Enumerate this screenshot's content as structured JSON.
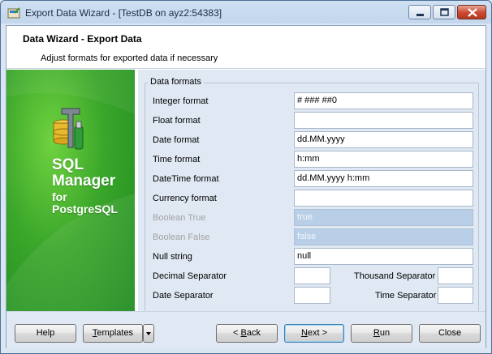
{
  "window": {
    "title": "Export Data Wizard - [TestDB on ayz2:54383]"
  },
  "header": {
    "title": "Data Wizard - Export Data",
    "subtitle": "Adjust formats for exported data if necessary"
  },
  "brand": {
    "line1": "SQL",
    "line2": "Manager",
    "line3": "for",
    "line4": "PostgreSQL"
  },
  "group": {
    "label": "Data formats"
  },
  "fields": {
    "integer_format": {
      "label": "Integer format",
      "value": "# ### ##0"
    },
    "float_format": {
      "label": "Float format",
      "value": ""
    },
    "date_format": {
      "label": "Date format",
      "value": "dd.MM.yyyy"
    },
    "time_format": {
      "label": "Time format",
      "value": "h:mm"
    },
    "datetime_format": {
      "label": "DateTime format",
      "value": "dd.MM.yyyy h:mm"
    },
    "currency_format": {
      "label": "Currency format",
      "value": ""
    },
    "boolean_true": {
      "label": "Boolean True",
      "value": "true"
    },
    "boolean_false": {
      "label": "Boolean False",
      "value": "false"
    },
    "null_string": {
      "label": "Null string",
      "value": "null"
    },
    "decimal_separator": {
      "label": "Decimal Separator",
      "value": ""
    },
    "thousand_separator": {
      "label": "Thousand Separator",
      "value": ""
    },
    "date_separator": {
      "label": "Date Separator",
      "value": ""
    },
    "time_separator": {
      "label": "Time Separator",
      "value": ""
    }
  },
  "buttons": {
    "help": "Help",
    "templates_hot": "T",
    "templates_rest": "emplates",
    "back_pre": "< ",
    "back_hot": "B",
    "back_rest": "ack",
    "next_hot": "N",
    "next_rest": "ext >",
    "run_hot": "R",
    "run_rest": "un",
    "close": "Close"
  },
  "icons": [
    "app-wizard-icon",
    "minimize-icon",
    "maximize-icon",
    "close-icon",
    "database-tools-icon",
    "dropdown-arrow-icon"
  ],
  "colors": {
    "accent_green": "#3aa62a",
    "disabled_field": "#b9cfe8",
    "close_red": "#c9492f"
  }
}
